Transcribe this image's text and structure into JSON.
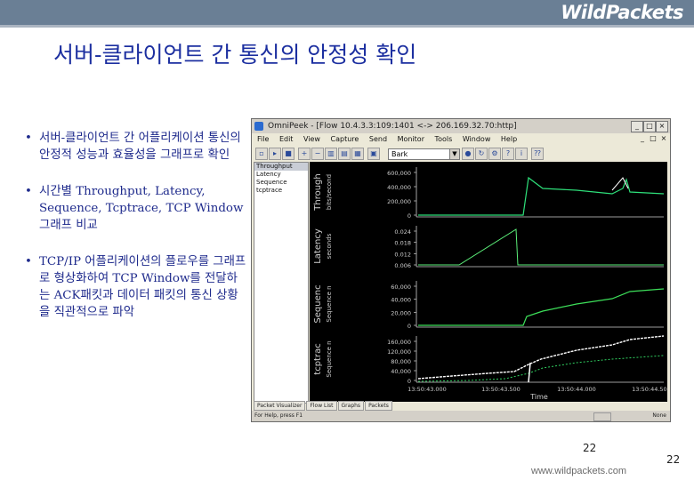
{
  "brand": {
    "logo": "WildPackets",
    "bar_color": "#6a7f95"
  },
  "slide": {
    "title": "서버-클라이언트 간 통신의 안정성 확인",
    "bullets": [
      "서버-클라이언트 간 어플리케이션 통신의 안정적 성능과 효율성을 그래프로 확인",
      "시간별 Throughput, Latency, Sequence, Tcptrace, TCP Window 그래프 비교",
      "TCP/IP 어플리케이션의 플로우를 그래프로 형상화하여 TCP Window를 전달하는 ACK패킷과 데이터 패킷의 통신 상황을 직관적으로 파악"
    ],
    "page_number": "22",
    "page_number_2": "22",
    "footer_url": "www.wildpackets.com"
  },
  "window": {
    "title": "OmniPeek - [Flow 10.4.3.3:109:1401 <-> 206.169.32.70:http]",
    "menu": [
      "File",
      "Edit",
      "View",
      "Capture",
      "Send",
      "Monitor",
      "Tools",
      "Window",
      "Help"
    ],
    "filter_value": "Bark",
    "panel_items": [
      "Throughput",
      "Latency",
      "Sequence",
      "tcptrace"
    ],
    "bottom_tabs": [
      "Packet Visualizer",
      "Flow List",
      "Graphs",
      "Packets"
    ],
    "status_text": "For Help, press F1",
    "status_right": "None",
    "graph": {
      "panels": [
        {
          "label": "Through",
          "unit": "bits/second",
          "ticks": [
            "600,000",
            "400,000",
            "200,000",
            "0"
          ]
        },
        {
          "label": "Latency",
          "unit": "seconds",
          "ticks": [
            "0.024",
            "0.018",
            "0.012",
            "0.006"
          ]
        },
        {
          "label": "Sequenc",
          "unit": "Sequence n",
          "ticks": [
            "60,000",
            "40,000",
            "20,000",
            "0"
          ]
        },
        {
          "label": "tcptrac",
          "unit": "Sequence n",
          "ticks": [
            "160,000",
            "120,000",
            "80,000",
            "40,000",
            "0"
          ]
        }
      ],
      "x_ticks": [
        "13:50:43.000",
        "13:50:43.500",
        "13:50:44.000",
        "13:50:44.500"
      ],
      "x_label": "Time",
      "colors": {
        "throughput": "#2ee07a",
        "latency": "#5cf07a",
        "sequence": "#3de05a",
        "trace_upper": "#ffffff",
        "trace_lower": "#30d060",
        "axis": "#cfcfcf"
      }
    }
  }
}
